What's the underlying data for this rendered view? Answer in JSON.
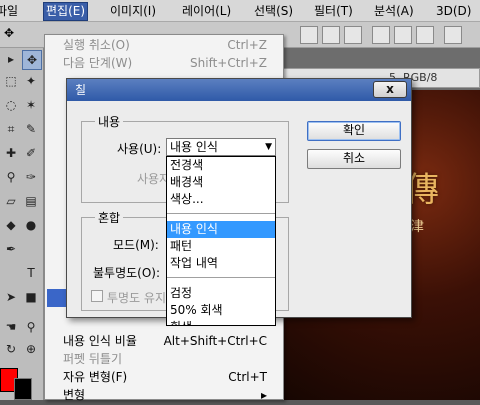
{
  "menubar": {
    "items": [
      {
        "label": "파일"
      },
      {
        "label": "편집(E)"
      },
      {
        "label": "이미지(I)"
      },
      {
        "label": "레이어(L)"
      },
      {
        "label": "선택(S)"
      },
      {
        "label": "필터(T)"
      },
      {
        "label": "분석(A)"
      },
      {
        "label": "3D(D)"
      }
    ],
    "active_item": "편집(E)"
  },
  "document": {
    "tab_info": "5, RGB/8"
  },
  "artwork": {
    "title_char": "傳",
    "subtitle": "永震道津"
  },
  "edit_menu": {
    "items": [
      {
        "label": "실행 취소(O)",
        "shortcut": "Ctrl+Z",
        "disabled": true
      },
      {
        "label": "다음 단계(W)",
        "shortcut": "Shift+Ctrl+Z",
        "disabled": true
      },
      {
        "label": "내용 인식 비율",
        "shortcut": "Alt+Shift+Ctrl+C",
        "disabled": false
      },
      {
        "label": "퍼펫 뒤틀기",
        "shortcut": "",
        "disabled": true
      },
      {
        "label": "자유 변형(F)",
        "shortcut": "Ctrl+T",
        "disabled": false
      },
      {
        "label": "변형",
        "shortcut": "",
        "disabled": false
      }
    ]
  },
  "fill_dialog": {
    "title": "칠",
    "close_label": "x",
    "content_group": "내용",
    "use_label": "사용(U):",
    "use_value": "내용 인식",
    "custom_pattern_label": "사용자",
    "blending_group": "혼합",
    "mode_label": "모드(M):",
    "opacity_label": "불투명도(O):",
    "preserve_transparency_label": "투명도 유지",
    "ok_label": "확인",
    "cancel_label": "취소",
    "use_options": [
      {
        "label": "전경색",
        "group": 1
      },
      {
        "label": "배경색",
        "group": 1
      },
      {
        "label": "색상...",
        "group": 1
      },
      {
        "label": "내용 인식",
        "group": 2,
        "selected": true
      },
      {
        "label": "패턴",
        "group": 2
      },
      {
        "label": "작업 내역",
        "group": 2
      },
      {
        "label": "검정",
        "group": 3
      },
      {
        "label": "50% 회색",
        "group": 3
      },
      {
        "label": "흰색",
        "group": 3
      }
    ]
  },
  "colors": {
    "foreground": "#ff0000",
    "background": "#000000",
    "menu_highlight": "#3a66c8",
    "list_highlight": "#3399ff"
  },
  "tools": [
    {
      "name": "move-tool-icon"
    },
    {
      "name": "marquee-tool-icon"
    },
    {
      "name": "lasso-tool-icon"
    },
    {
      "name": "quick-select-tool-icon"
    },
    {
      "name": "crop-tool-icon"
    },
    {
      "name": "eyedropper-tool-icon"
    },
    {
      "name": "healing-brush-icon"
    },
    {
      "name": "brush-tool-icon"
    },
    {
      "name": "clone-stamp-icon"
    },
    {
      "name": "history-brush-icon"
    },
    {
      "name": "eraser-tool-icon"
    },
    {
      "name": "gradient-tool-icon"
    },
    {
      "name": "blur-tool-icon"
    },
    {
      "name": "dodge-tool-icon"
    },
    {
      "name": "pen-tool-icon"
    },
    {
      "name": "type-tool-icon"
    },
    {
      "name": "path-select-icon"
    },
    {
      "name": "shape-tool-icon"
    },
    {
      "name": "hand-tool-icon"
    },
    {
      "name": "zoom-tool-icon"
    }
  ]
}
